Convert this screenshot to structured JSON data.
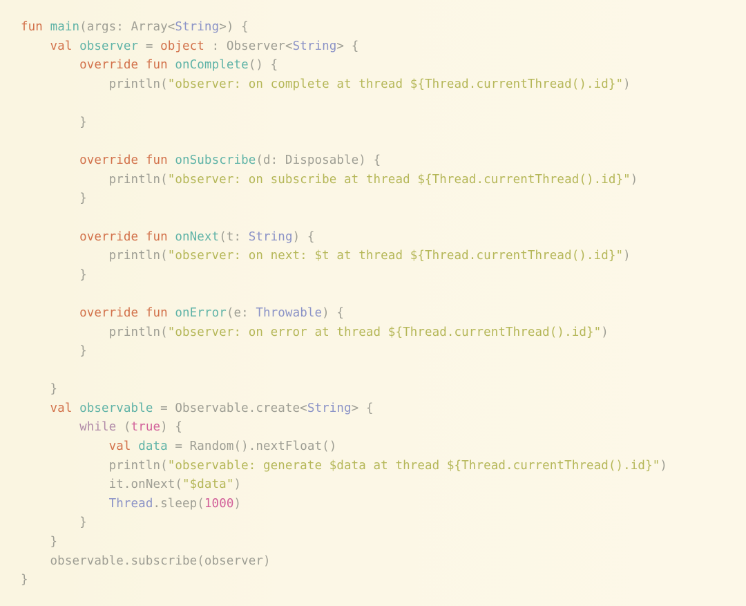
{
  "editor": {
    "language": "Kotlin",
    "background_color": "#fbf6e3",
    "font_size_px": 17.5,
    "theme_colors": {
      "keyword": "#d2714a",
      "function_name": "#5fb3a7",
      "plain": "#9e9e94",
      "type": "#8b93c7",
      "string": "#b5b758",
      "control": "#b08aa8",
      "number": "#d2619a"
    }
  },
  "code": {
    "lines": [
      {
        "n": 1,
        "text": "fun main(args: Array<String>) {",
        "tokens": [
          {
            "t": "fun",
            "c": "kw"
          },
          {
            "t": " ",
            "c": "plain"
          },
          {
            "t": "main",
            "c": "fn"
          },
          {
            "t": "(args: ",
            "c": "plain"
          },
          {
            "t": "Array",
            "c": "plain"
          },
          {
            "t": "<",
            "c": "plain"
          },
          {
            "t": "String",
            "c": "type"
          },
          {
            "t": ">) {",
            "c": "plain"
          }
        ]
      },
      {
        "n": 2,
        "text": "    val observer = object : Observer<String> {",
        "tokens": [
          {
            "t": "    ",
            "c": "plain"
          },
          {
            "t": "val",
            "c": "kw"
          },
          {
            "t": " ",
            "c": "plain"
          },
          {
            "t": "observer",
            "c": "fn"
          },
          {
            "t": " = ",
            "c": "plain"
          },
          {
            "t": "object",
            "c": "kw"
          },
          {
            "t": " : Observer<",
            "c": "plain"
          },
          {
            "t": "String",
            "c": "type"
          },
          {
            "t": "> {",
            "c": "plain"
          }
        ]
      },
      {
        "n": 3,
        "text": "        override fun onComplete() {",
        "tokens": [
          {
            "t": "        ",
            "c": "plain"
          },
          {
            "t": "override",
            "c": "kw"
          },
          {
            "t": " ",
            "c": "plain"
          },
          {
            "t": "fun",
            "c": "kw"
          },
          {
            "t": " ",
            "c": "plain"
          },
          {
            "t": "onComplete",
            "c": "fn"
          },
          {
            "t": "() {",
            "c": "plain"
          }
        ]
      },
      {
        "n": 4,
        "text": "            println(\"observer: on complete at thread ${Thread.currentThread().id}\")",
        "tokens": [
          {
            "t": "            ",
            "c": "plain"
          },
          {
            "t": "println",
            "c": "plain"
          },
          {
            "t": "(",
            "c": "plain"
          },
          {
            "t": "\"observer: on complete at thread ${Thread.currentThread().id}\"",
            "c": "str"
          },
          {
            "t": ")",
            "c": "plain"
          }
        ]
      },
      {
        "n": 5,
        "text": "",
        "tokens": []
      },
      {
        "n": 6,
        "text": "        }",
        "tokens": [
          {
            "t": "        }",
            "c": "plain"
          }
        ]
      },
      {
        "n": 7,
        "text": "",
        "tokens": []
      },
      {
        "n": 8,
        "text": "        override fun onSubscribe(d: Disposable) {",
        "tokens": [
          {
            "t": "        ",
            "c": "plain"
          },
          {
            "t": "override",
            "c": "kw"
          },
          {
            "t": " ",
            "c": "plain"
          },
          {
            "t": "fun",
            "c": "kw"
          },
          {
            "t": " ",
            "c": "plain"
          },
          {
            "t": "onSubscribe",
            "c": "fn"
          },
          {
            "t": "(d: Disposable) {",
            "c": "plain"
          }
        ]
      },
      {
        "n": 9,
        "text": "            println(\"observer: on subscribe at thread ${Thread.currentThread().id}\")",
        "tokens": [
          {
            "t": "            ",
            "c": "plain"
          },
          {
            "t": "println",
            "c": "plain"
          },
          {
            "t": "(",
            "c": "plain"
          },
          {
            "t": "\"observer: on subscribe at thread ${Thread.currentThread().id}\"",
            "c": "str"
          },
          {
            "t": ")",
            "c": "plain"
          }
        ]
      },
      {
        "n": 10,
        "text": "        }",
        "tokens": [
          {
            "t": "        }",
            "c": "plain"
          }
        ]
      },
      {
        "n": 11,
        "text": "",
        "tokens": []
      },
      {
        "n": 12,
        "text": "        override fun onNext(t: String) {",
        "tokens": [
          {
            "t": "        ",
            "c": "plain"
          },
          {
            "t": "override",
            "c": "kw"
          },
          {
            "t": " ",
            "c": "plain"
          },
          {
            "t": "fun",
            "c": "kw"
          },
          {
            "t": " ",
            "c": "plain"
          },
          {
            "t": "onNext",
            "c": "fn"
          },
          {
            "t": "(t: ",
            "c": "plain"
          },
          {
            "t": "String",
            "c": "type"
          },
          {
            "t": ") {",
            "c": "plain"
          }
        ]
      },
      {
        "n": 13,
        "text": "            println(\"observer: on next: $t at thread ${Thread.currentThread().id}\")",
        "tokens": [
          {
            "t": "            ",
            "c": "plain"
          },
          {
            "t": "println",
            "c": "plain"
          },
          {
            "t": "(",
            "c": "plain"
          },
          {
            "t": "\"observer: on next: $t at thread ${Thread.currentThread().id}\"",
            "c": "str"
          },
          {
            "t": ")",
            "c": "plain"
          }
        ]
      },
      {
        "n": 14,
        "text": "        }",
        "tokens": [
          {
            "t": "        }",
            "c": "plain"
          }
        ]
      },
      {
        "n": 15,
        "text": "",
        "tokens": []
      },
      {
        "n": 16,
        "text": "        override fun onError(e: Throwable) {",
        "tokens": [
          {
            "t": "        ",
            "c": "plain"
          },
          {
            "t": "override",
            "c": "kw"
          },
          {
            "t": " ",
            "c": "plain"
          },
          {
            "t": "fun",
            "c": "kw"
          },
          {
            "t": " ",
            "c": "plain"
          },
          {
            "t": "onError",
            "c": "fn"
          },
          {
            "t": "(e: ",
            "c": "plain"
          },
          {
            "t": "Throwable",
            "c": "type"
          },
          {
            "t": ") {",
            "c": "plain"
          }
        ]
      },
      {
        "n": 17,
        "text": "            println(\"observer: on error at thread ${Thread.currentThread().id}\")",
        "tokens": [
          {
            "t": "            ",
            "c": "plain"
          },
          {
            "t": "println",
            "c": "plain"
          },
          {
            "t": "(",
            "c": "plain"
          },
          {
            "t": "\"observer: on error at thread ${Thread.currentThread().id}\"",
            "c": "str"
          },
          {
            "t": ")",
            "c": "plain"
          }
        ]
      },
      {
        "n": 18,
        "text": "        }",
        "tokens": [
          {
            "t": "        }",
            "c": "plain"
          }
        ]
      },
      {
        "n": 19,
        "text": "",
        "tokens": []
      },
      {
        "n": 20,
        "text": "    }",
        "tokens": [
          {
            "t": "    }",
            "c": "plain"
          }
        ]
      },
      {
        "n": 21,
        "text": "    val observable = Observable.create<String> {",
        "tokens": [
          {
            "t": "    ",
            "c": "plain"
          },
          {
            "t": "val",
            "c": "kw"
          },
          {
            "t": " ",
            "c": "plain"
          },
          {
            "t": "observable",
            "c": "fn"
          },
          {
            "t": " = Observable.create<",
            "c": "plain"
          },
          {
            "t": "String",
            "c": "type"
          },
          {
            "t": "> {",
            "c": "plain"
          }
        ]
      },
      {
        "n": 22,
        "text": "        while (true) {",
        "tokens": [
          {
            "t": "        ",
            "c": "plain"
          },
          {
            "t": "while",
            "c": "ctrl"
          },
          {
            "t": " (",
            "c": "plain"
          },
          {
            "t": "true",
            "c": "num"
          },
          {
            "t": ") {",
            "c": "plain"
          }
        ]
      },
      {
        "n": 23,
        "text": "            val data = Random().nextFloat()",
        "tokens": [
          {
            "t": "            ",
            "c": "plain"
          },
          {
            "t": "val",
            "c": "kw"
          },
          {
            "t": " ",
            "c": "plain"
          },
          {
            "t": "data",
            "c": "fn"
          },
          {
            "t": " = Random().nextFloat()",
            "c": "plain"
          }
        ]
      },
      {
        "n": 24,
        "text": "            println(\"observable: generate $data at thread ${Thread.currentThread().id}\")",
        "tokens": [
          {
            "t": "            ",
            "c": "plain"
          },
          {
            "t": "println",
            "c": "plain"
          },
          {
            "t": "(",
            "c": "plain"
          },
          {
            "t": "\"observable: generate $data at thread ${Thread.currentThread().id}\"",
            "c": "str"
          },
          {
            "t": ")",
            "c": "plain"
          }
        ]
      },
      {
        "n": 25,
        "text": "            it.onNext(\"$data\")",
        "tokens": [
          {
            "t": "            ",
            "c": "plain"
          },
          {
            "t": "it.onNext(",
            "c": "plain"
          },
          {
            "t": "\"$data\"",
            "c": "str"
          },
          {
            "t": ")",
            "c": "plain"
          }
        ]
      },
      {
        "n": 26,
        "text": "            Thread.sleep(1000)",
        "tokens": [
          {
            "t": "            ",
            "c": "plain"
          },
          {
            "t": "Thread",
            "c": "type"
          },
          {
            "t": ".sleep(",
            "c": "plain"
          },
          {
            "t": "1000",
            "c": "num"
          },
          {
            "t": ")",
            "c": "plain"
          }
        ]
      },
      {
        "n": 27,
        "text": "        }",
        "tokens": [
          {
            "t": "        }",
            "c": "plain"
          }
        ]
      },
      {
        "n": 28,
        "text": "    }",
        "tokens": [
          {
            "t": "    }",
            "c": "plain"
          }
        ]
      },
      {
        "n": 29,
        "text": "    observable.subscribe(observer)",
        "tokens": [
          {
            "t": "    observable.subscribe(observer)",
            "c": "plain"
          }
        ]
      },
      {
        "n": 30,
        "text": "}",
        "tokens": [
          {
            "t": "}",
            "c": "plain"
          }
        ]
      }
    ]
  }
}
